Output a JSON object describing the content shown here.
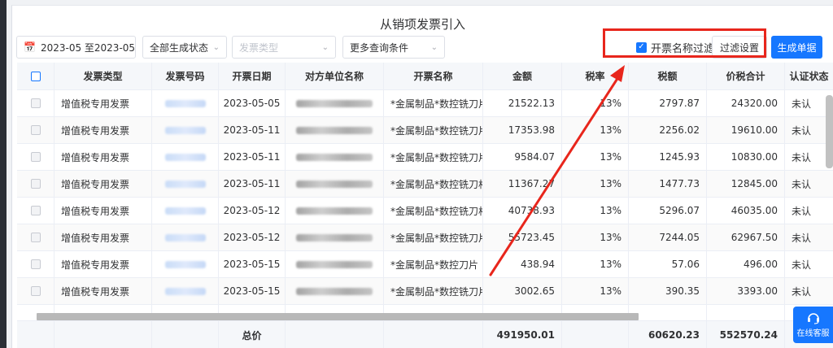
{
  "dialog": {
    "title": "从销项发票引入"
  },
  "filters": {
    "date_range": "2023-05 至2023-05",
    "status": "全部生成状态",
    "invoice_type_placeholder": "发票类型",
    "more": "更多查询条件"
  },
  "actions": {
    "name_filter_label": "开票名称过滤",
    "filter_settings": "过滤设置",
    "generate": "生成单据"
  },
  "table": {
    "headers": [
      "发票类型",
      "发票号码",
      "开票日期",
      "对方单位名称",
      "开票名称",
      "金额",
      "税率",
      "税额",
      "价税合计",
      "认证状态"
    ],
    "rows": [
      {
        "type": "增值税专用发票",
        "date": "2023-05-05",
        "item": "*金属制品*数控铣刀片",
        "amount": "21522.13",
        "rate": "13%",
        "tax": "2797.87",
        "total": "24320.00",
        "status": "未认"
      },
      {
        "type": "增值税专用发票",
        "date": "2023-05-11",
        "item": "*金属制品*数控铣刀片",
        "amount": "17353.98",
        "rate": "13%",
        "tax": "2256.02",
        "total": "19610.00",
        "status": "未认"
      },
      {
        "type": "增值税专用发票",
        "date": "2023-05-11",
        "item": "*金属制品*数控铣刀片",
        "amount": "9584.07",
        "rate": "13%",
        "tax": "1245.93",
        "total": "10830.00",
        "status": "未认"
      },
      {
        "type": "增值税专用发票",
        "date": "2023-05-11",
        "item": "*金属制品*数控铣刀杆...",
        "amount": "11367.27",
        "rate": "13%",
        "tax": "1477.73",
        "total": "12845.00",
        "status": "未认"
      },
      {
        "type": "增值税专用发票",
        "date": "2023-05-12",
        "item": "*金属制品*数控铣刀杆...",
        "amount": "40738.93",
        "rate": "13%",
        "tax": "5296.07",
        "total": "46035.00",
        "status": "未认"
      },
      {
        "type": "增值税专用发票",
        "date": "2023-05-12",
        "item": "*金属制品*数控铣刀片",
        "amount": "55723.45",
        "rate": "13%",
        "tax": "7244.05",
        "total": "62967.50",
        "status": "未认"
      },
      {
        "type": "增值税专用发票",
        "date": "2023-05-15",
        "item": "*金属制品*数控刀片 ...",
        "amount": "438.94",
        "rate": "13%",
        "tax": "57.06",
        "total": "496.00",
        "status": "未认"
      },
      {
        "type": "增值税专用发票",
        "date": "2023-05-15",
        "item": "*金属制品*数控铣刀片...",
        "amount": "3002.65",
        "rate": "13%",
        "tax": "390.35",
        "total": "3393.00",
        "status": "未认"
      }
    ],
    "footer": {
      "label": "总价",
      "amount": "491950.01",
      "tax": "60620.23",
      "total": "552570.24"
    }
  },
  "service": {
    "label": "在线客服",
    "icon": "headset-icon"
  },
  "colors": {
    "primary": "#1677ff",
    "annotation": "#e8261c"
  }
}
